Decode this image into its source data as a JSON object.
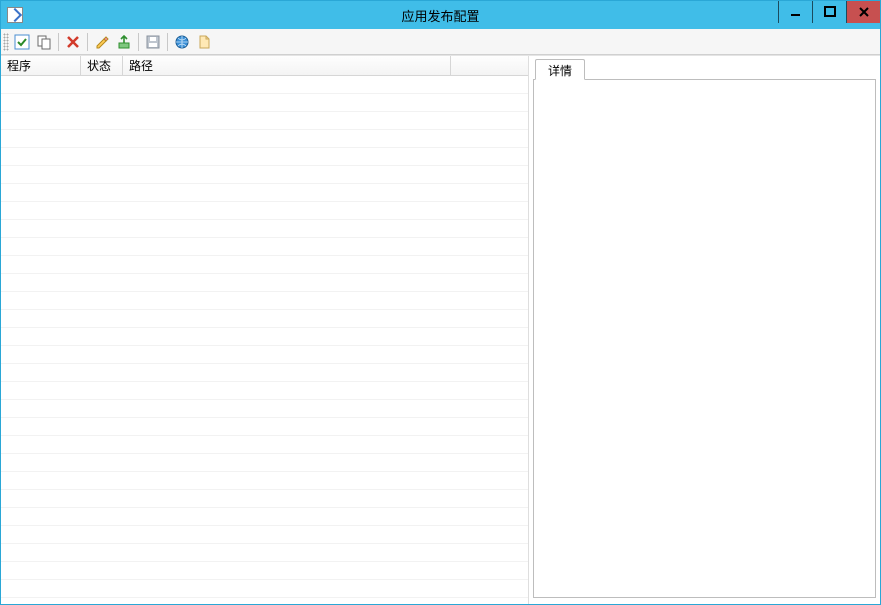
{
  "window": {
    "title": "应用发布配置"
  },
  "toolbar": {
    "icons": {
      "select_all": "select-all-icon",
      "copy": "copy-icon",
      "delete": "delete-icon",
      "edit": "edit-icon",
      "export": "export-icon",
      "save": "save-icon",
      "web": "web-icon",
      "document": "document-icon"
    }
  },
  "grid": {
    "columns": {
      "program": "程序",
      "status": "状态",
      "path": "路径"
    },
    "rows": []
  },
  "right": {
    "tab_detail": "详情"
  }
}
